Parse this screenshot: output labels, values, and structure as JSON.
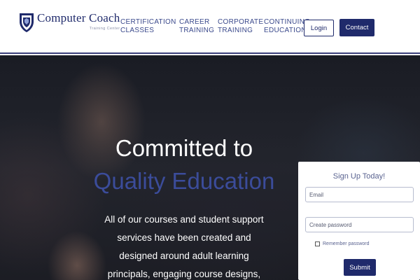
{
  "header": {
    "logo": {
      "title": "Computer Coach",
      "subtitle": "Training Center"
    },
    "nav": [
      {
        "line1": "CERTIFICATION",
        "line2": "CLASSES"
      },
      {
        "line1": "CAREER",
        "line2": "TRAINING"
      },
      {
        "line1": "CORPORATE",
        "line2": "TRAINING"
      },
      {
        "line1": "CONTINUING",
        "line2": "EDUCATION"
      }
    ],
    "login_label": "Login",
    "contact_label": "Contact"
  },
  "hero": {
    "headline_line1": "Committed to",
    "headline_line2": "Quality Education",
    "body": "All of our courses and student support services have been created and designed around adult learning principals, engaging course designs,"
  },
  "signup": {
    "title": "Sign Up Today!",
    "email_placeholder": "Email",
    "password_placeholder": "Create password",
    "remember_label": "Remember password",
    "submit_label": "Submit"
  },
  "colors": {
    "brand_navy": "#1f2a6b",
    "accent_blue": "#3b4c9a",
    "nav_text": "#3b4a8c"
  },
  "icons": {
    "logo": "shield-icon",
    "remember": "checkbox-icon"
  }
}
